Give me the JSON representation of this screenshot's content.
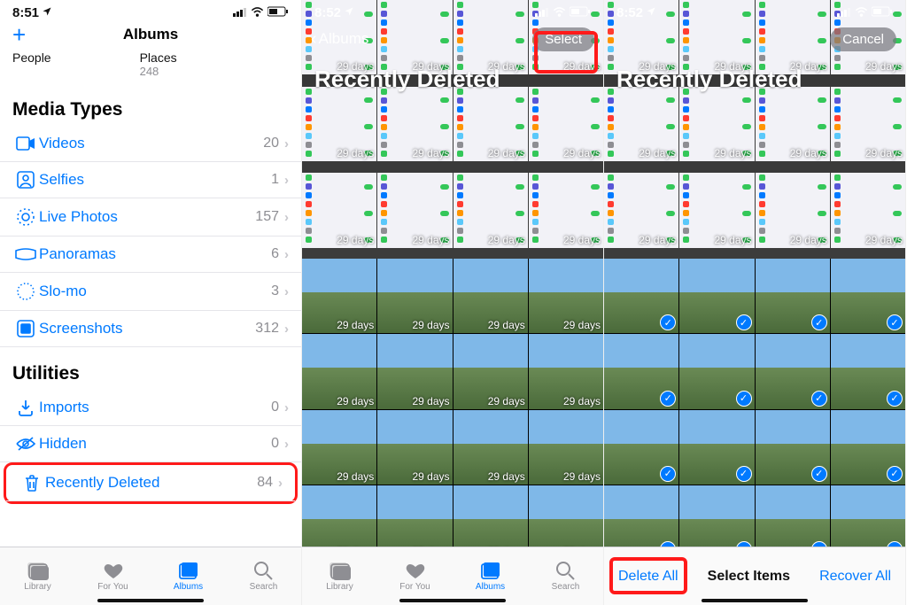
{
  "status": {
    "time1": "8:51",
    "time2": "8:52",
    "time3": "8:52"
  },
  "phone1": {
    "title": "Albums",
    "topItems": [
      {
        "label": "People",
        "count": ""
      },
      {
        "label": "Places",
        "count": "248"
      }
    ],
    "sections": [
      {
        "header": "Media Types",
        "rows": [
          {
            "icon": "video",
            "label": "Videos",
            "count": "20"
          },
          {
            "icon": "selfie",
            "label": "Selfies",
            "count": "1"
          },
          {
            "icon": "live",
            "label": "Live Photos",
            "count": "157"
          },
          {
            "icon": "pano",
            "label": "Panoramas",
            "count": "6"
          },
          {
            "icon": "slomo",
            "label": "Slo-mo",
            "count": "3"
          },
          {
            "icon": "screenshot",
            "label": "Screenshots",
            "count": "312"
          }
        ]
      },
      {
        "header": "Utilities",
        "rows": [
          {
            "icon": "import",
            "label": "Imports",
            "count": "0"
          },
          {
            "icon": "hidden",
            "label": "Hidden",
            "count": "0"
          },
          {
            "icon": "trash",
            "label": "Recently Deleted",
            "count": "84",
            "highlight": true
          }
        ]
      }
    ],
    "tabs": [
      {
        "label": "Library"
      },
      {
        "label": "For You"
      },
      {
        "label": "Albums",
        "selected": true
      },
      {
        "label": "Search"
      }
    ]
  },
  "phone2": {
    "back": "Albums",
    "select": "Select",
    "title": "Recently Deleted",
    "tabs": [
      {
        "label": "Library"
      },
      {
        "label": "For You"
      },
      {
        "label": "Albums",
        "selected": true
      },
      {
        "label": "Search"
      }
    ],
    "daysLabel": "29 days"
  },
  "phone3": {
    "cancel": "Cancel",
    "title": "Recently Deleted",
    "deleteAll": "Delete All",
    "selectItems": "Select Items",
    "recoverAll": "Recover All",
    "daysLabel": "29 days"
  },
  "icons": {
    "video": "▭",
    "selfie": "◻",
    "live": "◎",
    "pano": "▭",
    "slomo": "✺",
    "screenshot": "▣",
    "import": "⇩",
    "hidden": "👁",
    "trash": "🗑"
  }
}
